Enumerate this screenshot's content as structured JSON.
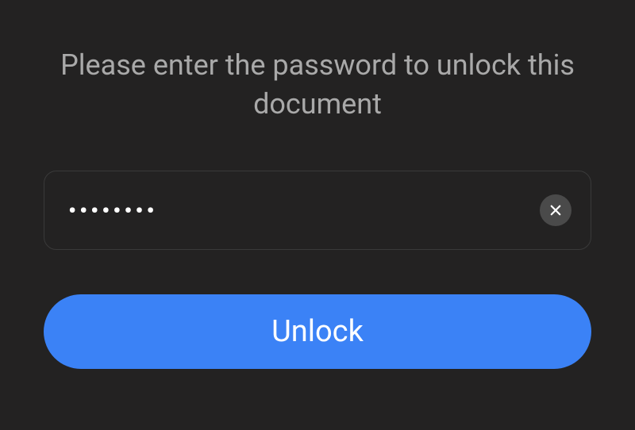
{
  "prompt": {
    "text": "Please enter the password to unlock this document"
  },
  "password_field": {
    "masked_value": "••••••••",
    "clear_icon": "close-icon"
  },
  "unlock_button": {
    "label": "Unlock"
  },
  "colors": {
    "background": "#232222",
    "text_muted": "#a9a9a9",
    "text_primary": "#ffffff",
    "button_primary": "#3b82f6",
    "input_border": "#3a3a3a",
    "clear_button_bg": "#4a4a4a"
  }
}
